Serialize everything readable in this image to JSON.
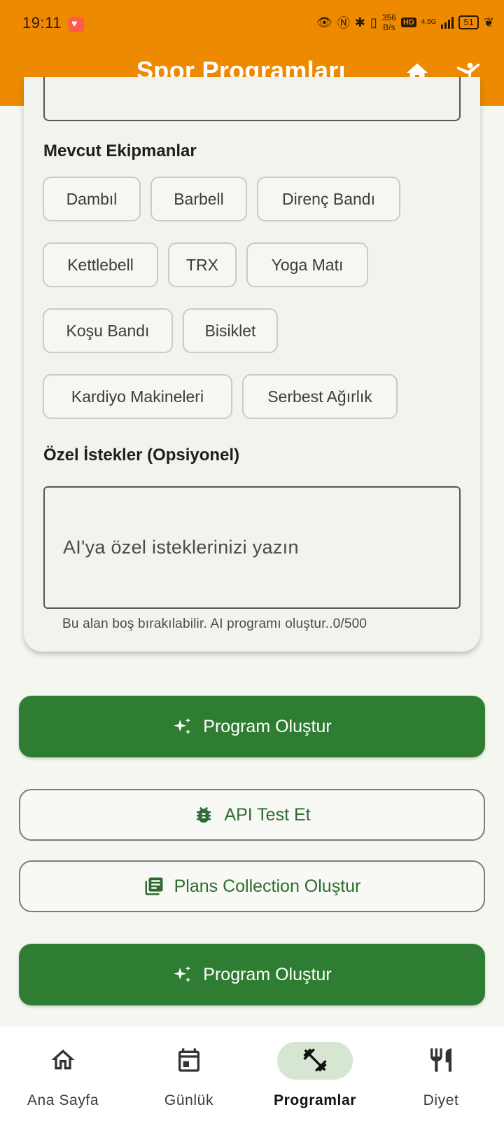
{
  "status_bar": {
    "time": "19:11",
    "net_speed_value": "356",
    "net_speed_unit": "B/s",
    "hd_label": "HD",
    "signal_label": "4.5G",
    "battery": "51"
  },
  "app_bar": {
    "title": "Spor Programları",
    "home_icon": "home-icon",
    "sport_icon": "sports-martial-arts-icon",
    "background_color": "#ed8a00"
  },
  "form": {
    "equipment_label": "Mevcut Ekipmanlar",
    "equipment": [
      "Dambıl",
      "Barbell",
      "Direnç Bandı",
      "Kettlebell",
      "TRX",
      "Yoga Matı",
      "Koşu Bandı",
      "Bisiklet",
      "Kardiyo Makineleri",
      "Serbest Ağırlık"
    ],
    "requests_label": "Özel İstekler (Opsiyonel)",
    "requests_placeholder": "AI'ya özel isteklerinizi yazın",
    "requests_helper": "Bu alan boş bırakılabilir. AI programı oluştur..",
    "requests_counter": "0/500"
  },
  "buttons": {
    "create_program_1": "Program Oluştur",
    "api_test": "API Test Et",
    "plans_collection": "Plans Collection Oluştur",
    "create_program_2": "Program Oluştur"
  },
  "bottom_nav": {
    "items": [
      {
        "label": "Ana Sayfa",
        "icon": "home-outline-icon",
        "active": false
      },
      {
        "label": "Günlük",
        "icon": "calendar-icon",
        "active": false
      },
      {
        "label": "Programlar",
        "icon": "fitness-center-icon",
        "active": true
      },
      {
        "label": "Diyet",
        "icon": "restaurant-icon",
        "active": false
      }
    ]
  },
  "colors": {
    "primary_green": "#2e7d32",
    "accent_orange": "#ed8a00"
  }
}
